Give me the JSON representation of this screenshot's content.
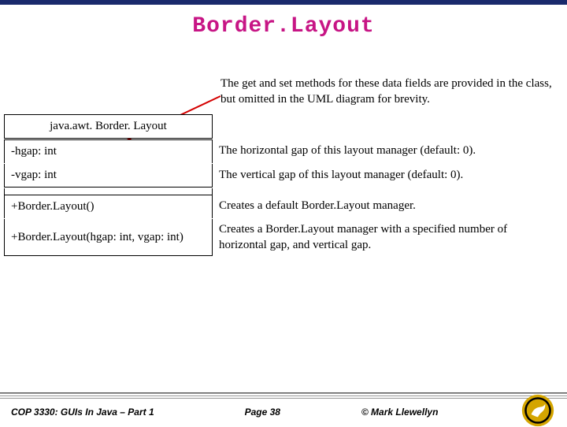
{
  "title": "Border.Layout",
  "note": "The get and set methods for these data fields are provided in the class, but omitted in the UML diagram for brevity.",
  "uml": {
    "className": "java.awt. Border. Layout",
    "fields": [
      {
        "sig": "-hgap: int",
        "desc": "The horizontal gap of this layout manager (default: 0)."
      },
      {
        "sig": "-vgap: int",
        "desc": "The vertical gap of this layout manager (default: 0)."
      }
    ],
    "methods": [
      {
        "sig": "+Border.Layout()",
        "desc": "Creates a default Border.Layout manager."
      },
      {
        "sig": "+Border.Layout(hgap: int, vgap: int)",
        "desc": "Creates a Border.Layout manager with a specified number of horizontal gap, and vertical gap."
      }
    ]
  },
  "footer": {
    "left": "COP 3330: GUIs In Java – Part 1",
    "center": "Page 38",
    "right": "© Mark Llewellyn"
  }
}
